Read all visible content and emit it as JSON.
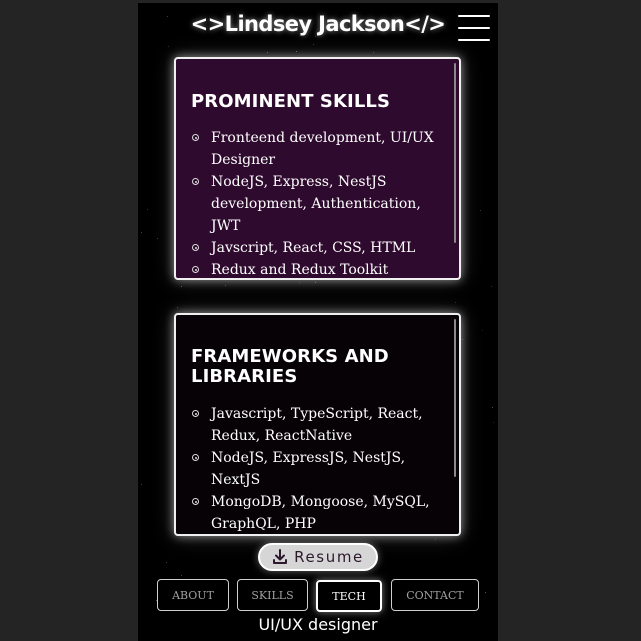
{
  "header": {
    "title": "<>Lindsey Jackson</>",
    "menu_icon": "hamburger-menu-icon"
  },
  "cards": [
    {
      "title": "PROMINENT SKILLS",
      "items": [
        "Fronteend development, UI/UX Designer",
        "NodeJS, Express, NestJS development, Authentication, JWT",
        "Javscript, React, CSS, HTML",
        "Redux and Redux Toolkit"
      ]
    },
    {
      "title": "FRAMEWORKS AND LIBRARIES",
      "items": [
        "Javascript, TypeScript, React, Redux, ReactNative",
        "NodeJS, ExpressJS, NestJS, NextJS",
        "MongoDB, Mongoose, MySQL, GraphQL, PHP"
      ]
    }
  ],
  "resume_button": {
    "label": "Resume",
    "icon": "download-icon"
  },
  "nav": [
    {
      "label": "ABOUT",
      "active": false
    },
    {
      "label": "SKILLS",
      "active": false
    },
    {
      "label": "TECH",
      "active": true
    },
    {
      "label": "CONTACT",
      "active": false
    }
  ],
  "footer": {
    "subtitle": "UI/UX designer"
  },
  "colors": {
    "page_background": "#242424",
    "app_background": "#000000",
    "skills_card_background": "#2e0a2e",
    "frameworks_card_background": "#060206",
    "resume_button_background": "#d6d6d6"
  }
}
